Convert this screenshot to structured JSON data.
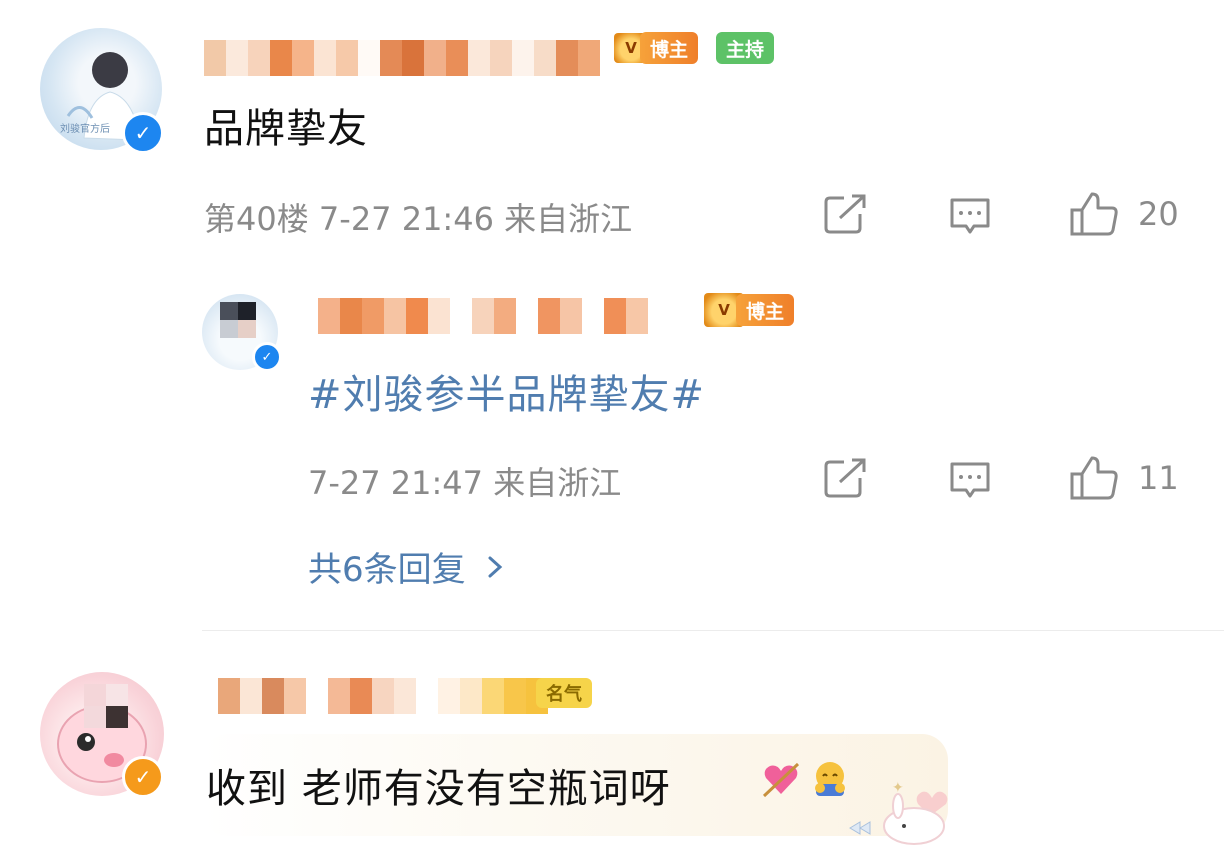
{
  "comments": [
    {
      "text": "品牌挚友",
      "floor": "第40楼",
      "time": "7-27 21:46",
      "location": "来自浙江",
      "likes": "20",
      "tags": [
        "博主",
        "主持"
      ],
      "avatar_caption": "刘骏官方后",
      "reply": {
        "hashtag": "#刘骏参半品牌挚友#",
        "time": "7-27 21:47",
        "location": "来自浙江",
        "likes": "11",
        "tags": [
          "博主"
        ]
      },
      "more_replies": "共6条回复"
    },
    {
      "text": "收到 老师有没有空瓶词呀",
      "emojis": [
        "heart-arrow-emoji",
        "hugging-emoji"
      ],
      "tags": [
        "名气"
      ]
    }
  ],
  "icons": {
    "share": "share-icon",
    "comment": "comment-icon",
    "like": "thumbs-up-icon",
    "chevron": "chevron-right-icon"
  },
  "colors": {
    "link": "#507daf",
    "meta": "#8a8a8a",
    "verified_blue": "#1d86f0",
    "verified_orange": "#f59a1b",
    "tag_orange": "#ef7f2a",
    "tag_green": "#5dc267"
  }
}
